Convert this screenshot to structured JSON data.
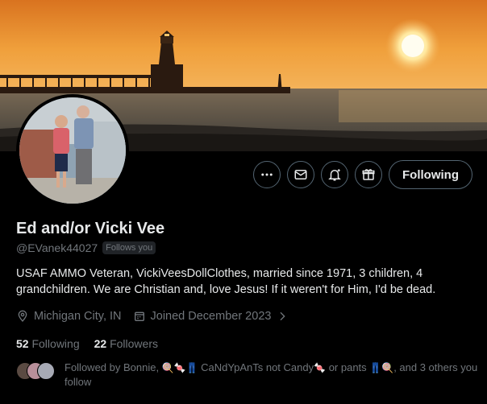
{
  "profile": {
    "name": "Ed and/or Vicki Vee",
    "handle": "@EVanek44027",
    "follows_you": "Follows you",
    "bio": "USAF AMMO Veteran, VickiVeesDollClothes, married since 1971, 3 children, 4 grandchildren. We are Christian and, love Jesus! If it weren't for Him, I'd be dead.",
    "location": "Michigan City, IN",
    "joined": "Joined December 2023"
  },
  "actions": {
    "follow_label": "Following"
  },
  "counts": {
    "following_num": "52",
    "following_label": "Following",
    "followers_num": "22",
    "followers_label": "Followers"
  },
  "followed_by": {
    "prefix": "Followed by Bonnie,",
    "emoji_a": "🍭🍬👖",
    "name2": "CaNdYpAnTs not Candy",
    "emoji_b": "🍬",
    "mid": "or pants",
    "emoji_c": "👖🍭",
    "suffix": ", and 3 others you follow"
  },
  "icons": [
    "more-icon",
    "message-icon",
    "notification-bell-icon",
    "subscribe-gift-icon",
    "location-icon",
    "calendar-icon",
    "chevron-right-icon"
  ]
}
